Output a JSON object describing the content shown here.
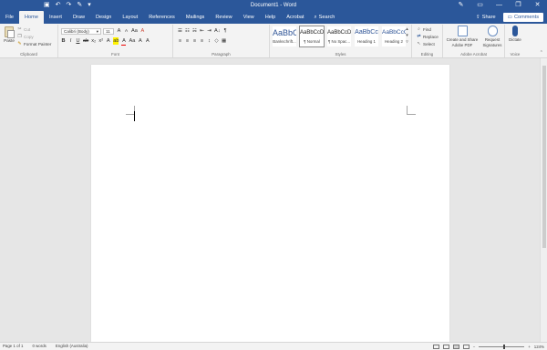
{
  "titlebar": {
    "title": "Document1 - Word",
    "qat": [
      {
        "icon": "save-icon",
        "glyph": "▣"
      },
      {
        "icon": "undo-icon",
        "glyph": "↶"
      },
      {
        "icon": "redo-icon",
        "glyph": "↷"
      },
      {
        "icon": "format-painter-icon",
        "glyph": "✎"
      },
      {
        "icon": "customize-qat-icon",
        "glyph": "▾"
      }
    ],
    "window_buttons": [
      {
        "icon": "pen-icon",
        "glyph": "✎"
      },
      {
        "icon": "ribbon-display-icon",
        "glyph": "▭"
      },
      {
        "icon": "minimize-icon",
        "glyph": "—"
      },
      {
        "icon": "restore-icon",
        "glyph": "❐"
      },
      {
        "icon": "close-icon",
        "glyph": "✕"
      }
    ]
  },
  "tabs": [
    "File",
    "Home",
    "Insert",
    "Draw",
    "Design",
    "Layout",
    "References",
    "Mailings",
    "Review",
    "View",
    "Help",
    "Acrobat"
  ],
  "active_tab": "Home",
  "search": {
    "icon": "search-icon",
    "glyph": "⌕",
    "label": "Search"
  },
  "share": {
    "icon": "share-icon",
    "glyph": "⇪",
    "label": "Share"
  },
  "comments": {
    "icon": "comment-icon",
    "glyph": "▭",
    "label": "Comments"
  },
  "ribbon": {
    "clipboard": {
      "label": "Clipboard",
      "paste": "Paste",
      "cut": "Cut",
      "copy": "Copy",
      "format_painter": "Format Painter"
    },
    "font": {
      "label": "Font",
      "font_name": "Calibri (Body)",
      "font_size": "11",
      "format_buttons": [
        "B",
        "I",
        "U",
        "ab",
        "x₂",
        "x²",
        "A",
        "ab",
        "A",
        "Aa",
        "A",
        "A"
      ]
    },
    "paragraph": {
      "label": "Paragraph",
      "row1": [
        "☰",
        "☷",
        "☵",
        "⇤",
        "⇥",
        "A↓",
        "¶"
      ],
      "row2": [
        "≡",
        "≡",
        "≡",
        "≡",
        "↕",
        "◇",
        "▦"
      ]
    },
    "styles": {
      "label": "Styles",
      "items": [
        {
          "preview": "AaBbC",
          "name": "Bankschrift..."
        },
        {
          "preview": "AaBbCcDc",
          "name": "¶ Normal"
        },
        {
          "preview": "AaBbCcDc",
          "name": "¶ No Spac..."
        },
        {
          "preview": "AaBbCc",
          "name": "Heading 1"
        },
        {
          "preview": "AaBbCcC",
          "name": "Heading 2"
        }
      ]
    },
    "editing": {
      "label": "Editing",
      "find": "Find",
      "replace": "Replace",
      "select": "Select"
    },
    "adobe": {
      "label": "Adobe Acrobat",
      "create_share_line1": "Create and Share",
      "create_share_line2": "Adobe PDF",
      "request_line1": "Request",
      "request_line2": "Signatures"
    },
    "voice": {
      "label": "Voice",
      "dictate": "Dictate"
    }
  },
  "status": {
    "page": "Page 1 of 1",
    "words": "0 words",
    "language": "English (Australia)",
    "zoom": "124%",
    "zoom_level_percent": 124
  },
  "colors": {
    "brand": "#2b579a",
    "ribbon_bg": "#f3f3f3",
    "canvas_bg": "#e6e6e6"
  }
}
